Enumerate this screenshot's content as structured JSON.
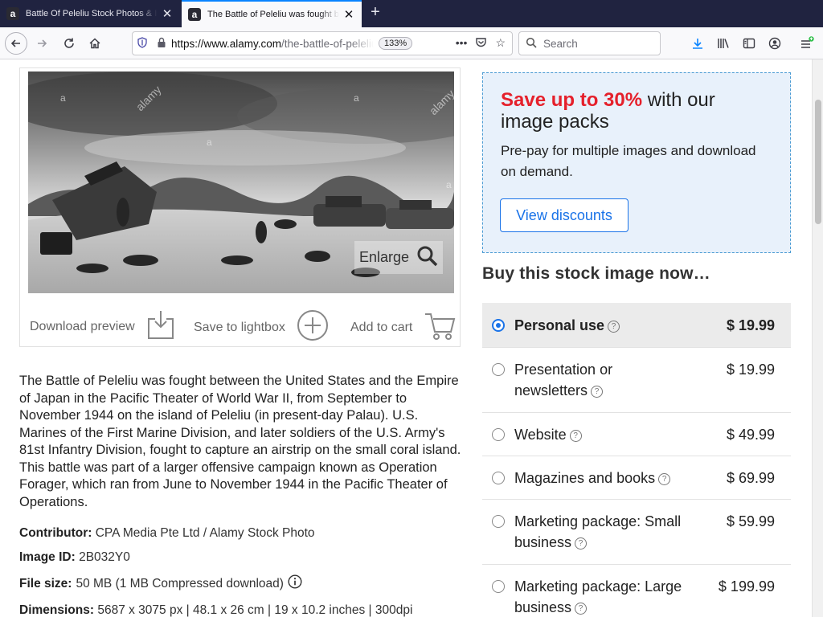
{
  "browser": {
    "tabs": [
      {
        "favicon": "a",
        "title": "Battle Of Peleliu Stock Photos & Ima",
        "active": false
      },
      {
        "favicon": "a",
        "title": "The Battle of Peleliu was fought bet",
        "active": true
      }
    ],
    "url_host": "https://www.alamy.com",
    "url_path": "/the-battle-of-peleliu",
    "zoom": "133%",
    "search_placeholder": "Search"
  },
  "image_card": {
    "enlarge_label": "Enlarge",
    "watermark": "alamy",
    "watermark_letter": "a",
    "actions": {
      "download_preview": "Download preview",
      "save_to_lightbox": "Save to lightbox",
      "add_to_cart": "Add to cart"
    }
  },
  "description": "The Battle of Peleliu was fought between the United States and the Empire of Japan in the Pacific Theater of World War II, from September to November 1944 on the island of Peleliu (in present-day Palau). U.S. Marines of the First Marine Division, and later soldiers of the U.S. Army's 81st Infantry Division, fought to capture an airstrip on the small coral island. This battle was part of a larger offensive campaign known as Operation Forager, which ran from June to November 1944 in the Pacific Theater of Operations.",
  "meta": {
    "contributor_label": "Contributor:",
    "contributor_value": "CPA Media Pte Ltd / Alamy Stock Photo",
    "image_id_label": "Image ID:",
    "image_id_value": "2B032Y0",
    "file_size_label": "File size:",
    "file_size_value": "50 MB (1 MB Compressed download)",
    "dimensions_label": "Dimensions:",
    "dimensions_value": "5687 x 3075 px | 48.1 x 26 cm | 19 x 10.2 inches | 300dpi"
  },
  "promo": {
    "highlight": "Save up to 30%",
    "title_rest": " with our image packs",
    "subtitle": "Pre-pay for multiple images and download on demand.",
    "button": "View discounts"
  },
  "buy_heading": "Buy this stock image now…",
  "licenses": [
    {
      "label": "Personal use",
      "price": "$ 19.99",
      "selected": true
    },
    {
      "label": "Presentation or newsletters",
      "price": "$ 19.99",
      "selected": false
    },
    {
      "label": "Website",
      "price": "$ 49.99",
      "selected": false
    },
    {
      "label": "Magazines and books",
      "price": "$ 69.99",
      "selected": false
    },
    {
      "label": "Marketing package: Small business",
      "price": "$ 59.99",
      "selected": false
    },
    {
      "label": "Marketing package: Large business",
      "price": "$ 199.99",
      "selected": false
    }
  ],
  "colors": {
    "promo_highlight": "#e5202b",
    "accent_blue": "#1a73e8",
    "promo_background": "#e8f1fb",
    "tabbar": "#202340"
  }
}
